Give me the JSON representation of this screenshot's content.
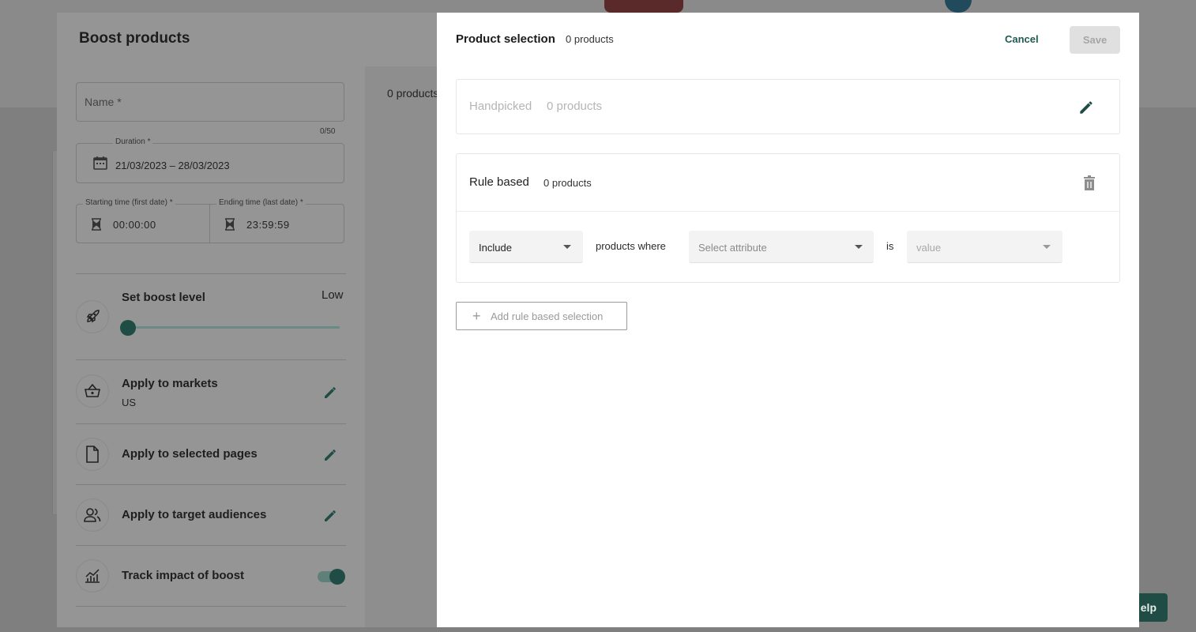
{
  "background": {
    "help_label": "elp"
  },
  "boost_dialog": {
    "title": "Boost products",
    "name_placeholder": "Name *",
    "name_counter": "0/50",
    "duration_label": "Duration *",
    "duration_value": "21/03/2023 – 28/03/2023",
    "start_time_label": "Starting time (first date) *",
    "start_time_value": "00:00:00",
    "end_time_label": "Ending time (last date) *",
    "end_time_value": "23:59:59",
    "products_count": "0 products",
    "boost_level": {
      "label": "Set boost level",
      "value_label": "Low",
      "level_fraction": 0
    },
    "markets": {
      "label": "Apply to markets",
      "value": "US"
    },
    "pages_label": "Apply to selected pages",
    "audiences_label": "Apply to target audiences",
    "track": {
      "label": "Track impact of boost",
      "enabled": true
    }
  },
  "product_selection": {
    "title": "Product selection",
    "count": "0 products",
    "cancel_label": "Cancel",
    "save_label": "Save",
    "handpicked": {
      "label": "Handpicked",
      "count": "0 products"
    },
    "rule_based": {
      "label": "Rule based",
      "count": "0 products",
      "include_value": "Include",
      "products_where": "products where",
      "attribute_placeholder": "Select attribute",
      "is_label": "is",
      "value_placeholder": "value"
    },
    "add_rule_label": "Add rule based selection"
  },
  "colors": {
    "accent": "#1f4d45",
    "link": "#1f5a52",
    "overlay": "#7f7f7f",
    "save_disabled_bg": "#e0e0e0"
  }
}
